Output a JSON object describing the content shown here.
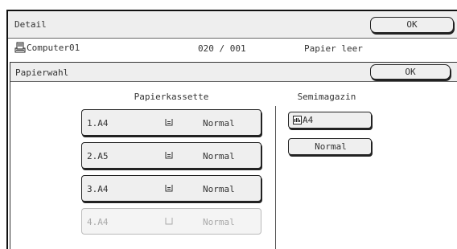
{
  "header": {
    "title": "Detail",
    "ok_label": "OK"
  },
  "info": {
    "computer": "Computer01",
    "count": "020 / 001",
    "status": "Papier leer"
  },
  "dialog": {
    "title": "Papierwahl",
    "ok_label": "OK"
  },
  "trays": {
    "heading": "Papierkassette",
    "items": [
      {
        "name": "1.A4",
        "type": "Normal",
        "icon": "tray-loaded-icon",
        "enabled": true
      },
      {
        "name": "2.A5",
        "type": "Normal",
        "icon": "tray-loaded-icon",
        "enabled": true
      },
      {
        "name": "3.A4",
        "type": "Normal",
        "icon": "tray-loaded-icon",
        "enabled": true
      },
      {
        "name": "4.A4",
        "type": "Normal",
        "icon": "tray-empty-icon",
        "enabled": false
      }
    ]
  },
  "bypass": {
    "heading": "Semimagazin",
    "size": "A4",
    "size_icon": "bypass-tray-icon",
    "type": "Normal"
  }
}
